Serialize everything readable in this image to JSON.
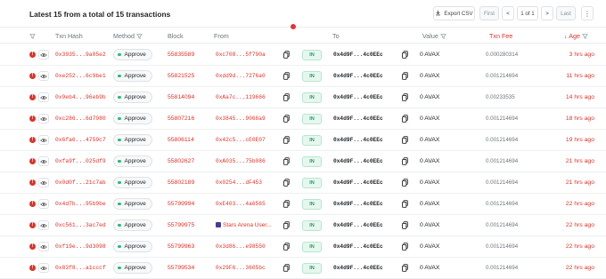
{
  "header": {
    "summary": "Latest 15 from a total of 15 transactions",
    "export_label": "Export CSV",
    "pager": {
      "first": "First",
      "prev": "<",
      "info": "1 of 1",
      "next": ">",
      "last": "Last"
    },
    "more": "⋮"
  },
  "columns": {
    "txn_hash": "Txn Hash",
    "method": "Method",
    "block": "Block",
    "from": "From",
    "to": "To",
    "value": "Value",
    "fee": "Txn Fee",
    "age": "Age"
  },
  "rows": [
    {
      "hash": "0x3935...9a05e2",
      "method": "Approve",
      "block": "55835589",
      "from": "0xc708...5f790a",
      "direction": "IN",
      "to": "0x4d9F...4c0EEc",
      "value": "0 AVAX",
      "fee": "0.000280314",
      "age": "3 hrs ago"
    },
    {
      "hash": "0xe252...6c9be1",
      "method": "Approve",
      "block": "55821525",
      "from": "0xdd9d...7276a0",
      "direction": "IN",
      "to": "0x4d9F...4c0EEc",
      "value": "0 AVAX",
      "fee": "0.001214694",
      "age": "11 hrs ago"
    },
    {
      "hash": "0x9eb4...96eb9b",
      "method": "Approve",
      "block": "55814094",
      "from": "0xAa7c...119666",
      "direction": "IN",
      "to": "0x4d9F...4c0EEc",
      "value": "0 AVAX",
      "fee": "0.00233535",
      "age": "14 hrs ago"
    },
    {
      "hash": "0xc286...6d7080",
      "method": "Approve",
      "block": "55807216",
      "from": "0x3845...9068a9",
      "direction": "IN",
      "to": "0x4d9F...4c0EEc",
      "value": "0 AVAX",
      "fee": "0.001214694",
      "age": "18 hrs ago"
    },
    {
      "hash": "0x6fa6...4759c7",
      "method": "Approve",
      "block": "55806114",
      "from": "0x42c5...cE0E07",
      "direction": "IN",
      "to": "0x4d9F...4c0EEc",
      "value": "0 AVAX",
      "fee": "0.001214694",
      "age": "19 hrs ago"
    },
    {
      "hash": "0xfa9f...025df9",
      "method": "Approve",
      "block": "55802627",
      "from": "0xA035...75b086",
      "direction": "IN",
      "to": "0x4d9F...4c0EEc",
      "value": "0 AVAX",
      "fee": "0.001214694",
      "age": "21 hrs ago"
    },
    {
      "hash": "0x0d0f...21c7ab",
      "method": "Approve",
      "block": "55802189",
      "from": "0x0254...dF453",
      "direction": "IN",
      "to": "0x4d9F...4c0EEc",
      "value": "0 AVAX",
      "fee": "0.001214694",
      "age": "21 hrs ago"
    },
    {
      "hash": "0x4d7b...95b9be",
      "method": "Approve",
      "block": "55799994",
      "from": "0xE403...4a6565",
      "direction": "IN",
      "to": "0x4d9F...4c0EEc",
      "value": "0 AVAX",
      "fee": "0.001214694",
      "age": "22 hrs ago"
    },
    {
      "hash": "0xc561...3ac7ed",
      "method": "Approve",
      "block": "55799975",
      "from": "Stars Arena User...",
      "from_named": true,
      "direction": "IN",
      "to": "0x4d9F...4c0EEc",
      "value": "0 AVAX",
      "fee": "0.001214694",
      "age": "22 hrs ago"
    },
    {
      "hash": "0xf19e...9d3098",
      "method": "Approve",
      "block": "55799963",
      "from": "0x3d86...e98550",
      "direction": "IN",
      "to": "0x4d9F...4c0EEc",
      "value": "0 AVAX",
      "fee": "0.001214694",
      "age": "22 hrs ago"
    },
    {
      "hash": "0x83f8...a1cccf",
      "method": "Approve",
      "block": "55799534",
      "from": "0x29F6...3605bc",
      "direction": "IN",
      "to": "0x4d9F...4c0EEc",
      "value": "0 AVAX",
      "fee": "0.001214694",
      "age": "22 hrs ago"
    }
  ],
  "icons": {
    "alert": "alert-icon",
    "eye": "eye-icon",
    "copy": "copy-icon",
    "filter": "filter-icon",
    "download": "download-icon",
    "sort": "sort-down-icon"
  },
  "colors": {
    "link_red": "#d9342b",
    "approve_dot": "#2eb872",
    "in_badge_bg": "#e6f7ef",
    "in_badge_text": "#2a9d62"
  }
}
